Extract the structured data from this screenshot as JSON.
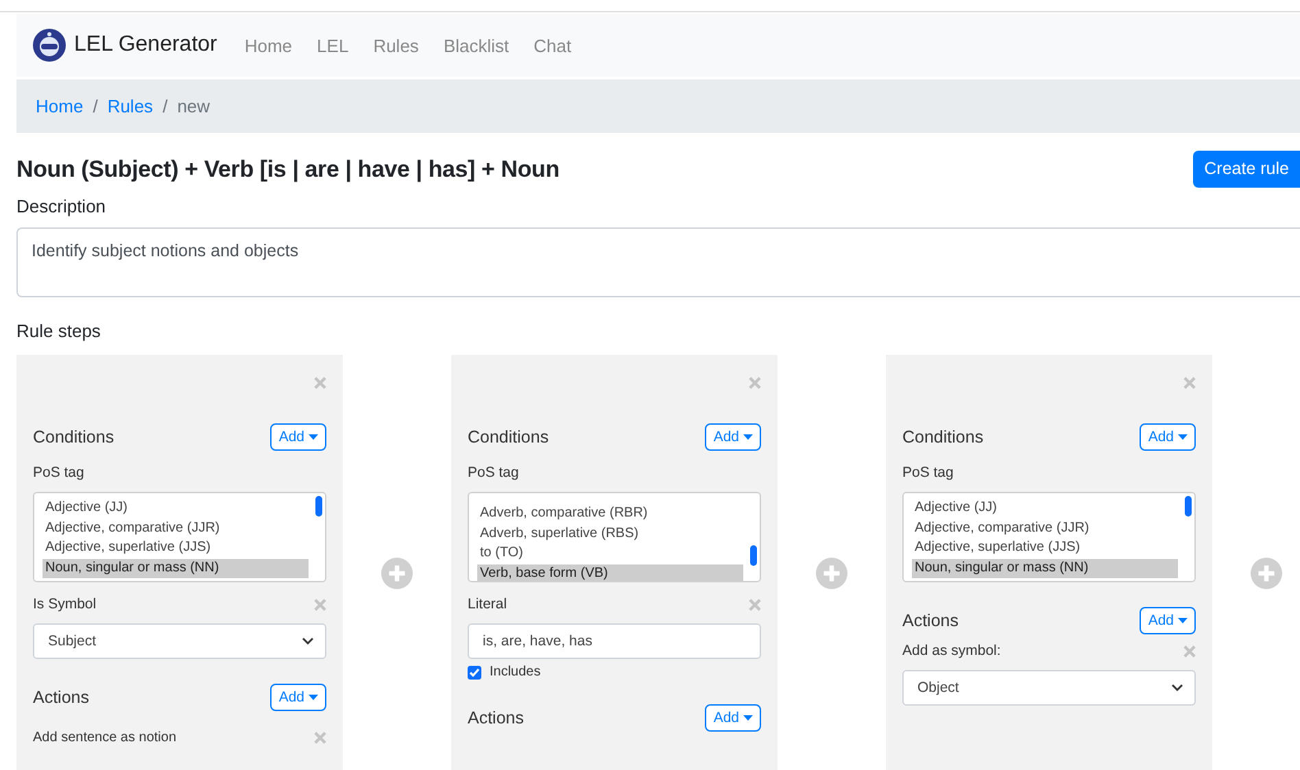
{
  "navbar": {
    "brand": "LEL Generator",
    "links": [
      "Home",
      "LEL",
      "Rules",
      "Blacklist",
      "Chat"
    ]
  },
  "breadcrumb": {
    "links": [
      "Home",
      "Rules"
    ],
    "separator": "/",
    "current": "new"
  },
  "title": "Noun (Subject) + Verb [is | are | have | has] + Noun",
  "create_button": "Create rule",
  "description": {
    "label": "Description",
    "value": "Identify subject notions and objects"
  },
  "rule_steps_label": "Rule steps",
  "steps": [
    {
      "conditions_label": "Conditions",
      "conditions_add": "Add",
      "conditions": [
        {
          "kind": "listbox",
          "label": "PoS tag",
          "options": [
            {
              "label": "Adjective (JJ)",
              "selected": false
            },
            {
              "label": "Adjective, comparative (JJR)",
              "selected": false
            },
            {
              "label": "Adjective, superlative (JJS)",
              "selected": false
            },
            {
              "label": "Noun, singular or mass (NN)",
              "selected": true
            }
          ]
        },
        {
          "kind": "select",
          "label": "Is Symbol",
          "value": "Subject"
        }
      ],
      "actions_label": "Actions",
      "actions_add": "Add",
      "actions": [
        {
          "kind": "text",
          "label": "Add sentence as notion"
        }
      ]
    },
    {
      "conditions_label": "Conditions",
      "conditions_add": "Add",
      "conditions": [
        {
          "kind": "listbox",
          "label": "PoS tag",
          "options": [
            {
              "label": "Adverb, comparative (RBR)",
              "selected": false
            },
            {
              "label": "Adverb, superlative (RBS)",
              "selected": false
            },
            {
              "label": "to (TO)",
              "selected": false
            },
            {
              "label": "Verb, base form (VB)",
              "selected": true
            }
          ]
        },
        {
          "kind": "literal",
          "label": "Literal",
          "value": "is, are, have, has",
          "checkbox": {
            "label": "Includes",
            "checked": true
          }
        }
      ],
      "actions_label": "Actions",
      "actions_add": "Add"
    },
    {
      "conditions_label": "Conditions",
      "conditions_add": "Add",
      "conditions": [
        {
          "kind": "listbox",
          "label": "PoS tag",
          "options": [
            {
              "label": "Adjective (JJ)",
              "selected": false
            },
            {
              "label": "Adjective, comparative (JJR)",
              "selected": false
            },
            {
              "label": "Adjective, superlative (JJS)",
              "selected": false
            },
            {
              "label": "Noun, singular or mass (NN)",
              "selected": true
            }
          ]
        }
      ],
      "actions_label": "Actions",
      "actions_add": "Add",
      "actions": [
        {
          "kind": "select",
          "label": "Add as symbol:",
          "value": "Object"
        }
      ]
    }
  ]
}
